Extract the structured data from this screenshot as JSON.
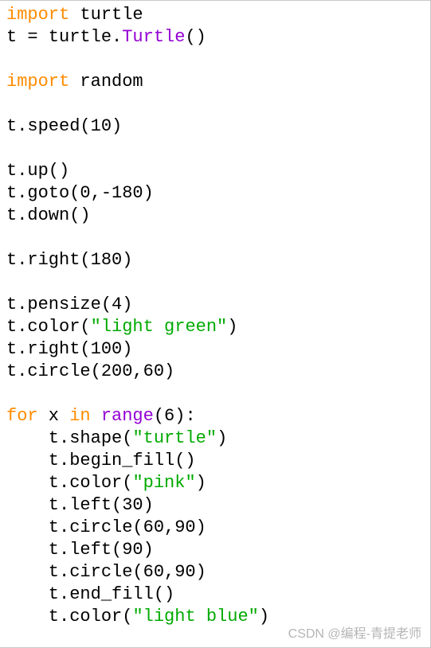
{
  "code": {
    "line1_import": "import",
    "line1_rest": " turtle",
    "line2_a": "t = turtle.",
    "line2_func": "Turtle",
    "line2_b": "()",
    "line4_import": "import",
    "line4_rest": " random",
    "line6": "t.speed(10)",
    "line8": "t.up()",
    "line9": "t.goto(0,-180)",
    "line10": "t.down()",
    "line12": "t.right(180)",
    "line14": "t.pensize(4)",
    "line15_a": "t.color(",
    "line15_str": "\"light green\"",
    "line15_b": ")",
    "line16": "t.right(100)",
    "line17": "t.circle(200,60)",
    "line19_for": "for",
    "line19_mid": " x ",
    "line19_in": "in",
    "line19_sp": " ",
    "line19_range": "range",
    "line19_end": "(6):",
    "line20_a": "    t.shape(",
    "line20_str": "\"turtle\"",
    "line20_b": ")",
    "line21": "    t.begin_fill()",
    "line22_a": "    t.color(",
    "line22_str": "\"pink\"",
    "line22_b": ")",
    "line23": "    t.left(30)",
    "line24": "    t.circle(60,90)",
    "line25": "    t.left(90)",
    "line26": "    t.circle(60,90)",
    "line27": "    t.end_fill()",
    "line28_a": "    t.color(",
    "line28_str": "\"light blue\"",
    "line28_b": ")"
  },
  "watermark": "CSDN @编程-青提老师"
}
